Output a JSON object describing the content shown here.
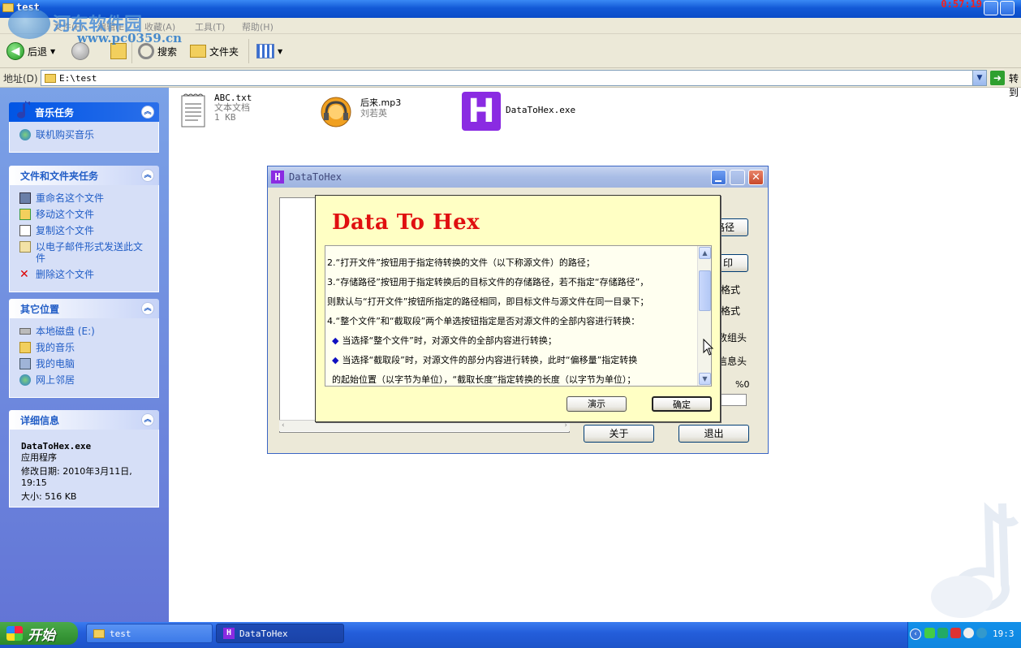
{
  "window": {
    "title": "test",
    "clock_overlay": "0:57:19"
  },
  "watermark": {
    "site_name": "河东软件园",
    "url": "www.pc0359.cn"
  },
  "menubar": {
    "items": [
      "文件(F)",
      "编辑(E)",
      "查看(V)",
      "收藏(A)",
      "工具(T)",
      "帮助(H)"
    ]
  },
  "toolbar": {
    "back": "后退",
    "search": "搜索",
    "folders": "文件夹"
  },
  "addressbar": {
    "label": "地址(D)",
    "path": "E:\\test",
    "go": "转到"
  },
  "taskpane": {
    "music": {
      "title": "音乐任务",
      "items": [
        "联机购买音乐"
      ]
    },
    "file_tasks": {
      "title": "文件和文件夹任务",
      "items": [
        "重命名这个文件",
        "移动这个文件",
        "复制这个文件",
        "以电子邮件形式发送此文件",
        "删除这个文件"
      ]
    },
    "other_places": {
      "title": "其它位置",
      "items": [
        "本地磁盘 (E:)",
        "我的音乐",
        "我的电脑",
        "网上邻居"
      ]
    },
    "details": {
      "title": "详细信息",
      "filename": "DataToHex.exe",
      "type": "应用程序",
      "modified": "修改日期: 2010年3月11日, 19:15",
      "size": "大小: 516 KB"
    }
  },
  "files": [
    {
      "name": "ABC.txt",
      "type": "文本文档",
      "size": "1 KB"
    },
    {
      "name": "后来.mp3",
      "artist": "刘若英"
    },
    {
      "name": "DataToHex.exe",
      "icon_letter": "H"
    }
  ],
  "app": {
    "title": "DataToHex",
    "right_buttons": [
      "路径",
      "印"
    ],
    "right_labels": [
      "格式",
      "格式",
      "数组头",
      "信息头",
      "%0"
    ],
    "about": "关于",
    "exit": "退出"
  },
  "dialog": {
    "heading": "Data To Hex",
    "lines": [
      "2.“打开文件”按钮用于指定待转换的文件（以下称源文件）的路径；",
      "3.“存储路径”按钮用于指定转换后的目标文件的存储路径，若不指定“存储路径”，",
      "则默认与“打开文件”按钮所指定的路径相同，即目标文件与源文件在同一目录下；",
      "4.“整个文件”和“截取段”两个单选按钮指定是否对源文件的全部内容进行转换：",
      "当选择“整个文件”时，对源文件的全部内容进行转换；",
      "当选择“截取段”时，对源文件的部分内容进行转换，此时“偏移量”指定转换",
      "的起始位置（以字节为单位），“截取长度”指定转换的长度（以字节为单位）；"
    ],
    "demo": "演示",
    "ok": "确定"
  },
  "taskbar": {
    "start": "开始",
    "tasks": [
      "test",
      "DataToHex"
    ],
    "time": "19:3"
  },
  "colors": {
    "xp_blue": "#245edb",
    "start_green": "#3a9a3a",
    "heading_red": "#e01010",
    "dialog_bg": "#ffffc4"
  }
}
